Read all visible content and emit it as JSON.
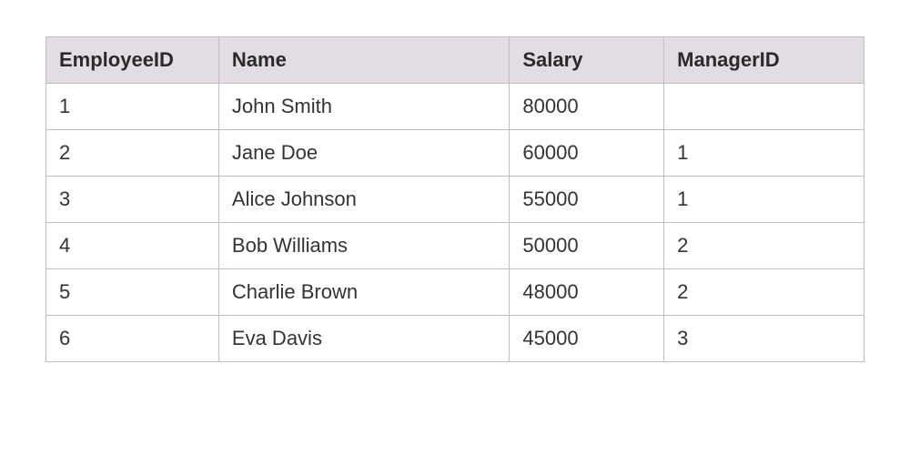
{
  "chart_data": {
    "type": "table",
    "headers": [
      "EmployeeID",
      "Name",
      "Salary",
      "ManagerID"
    ],
    "rows": [
      {
        "EmployeeID": "1",
        "Name": "John Smith",
        "Salary": "80000",
        "ManagerID": ""
      },
      {
        "EmployeeID": "2",
        "Name": "Jane Doe",
        "Salary": "60000",
        "ManagerID": "1"
      },
      {
        "EmployeeID": "3",
        "Name": "Alice Johnson",
        "Salary": "55000",
        "ManagerID": "1"
      },
      {
        "EmployeeID": "4",
        "Name": "Bob Williams",
        "Salary": "50000",
        "ManagerID": "2"
      },
      {
        "EmployeeID": "5",
        "Name": "Charlie Brown",
        "Salary": "48000",
        "ManagerID": "2"
      },
      {
        "EmployeeID": "6",
        "Name": "Eva Davis",
        "Salary": "45000",
        "ManagerID": "3"
      }
    ]
  }
}
